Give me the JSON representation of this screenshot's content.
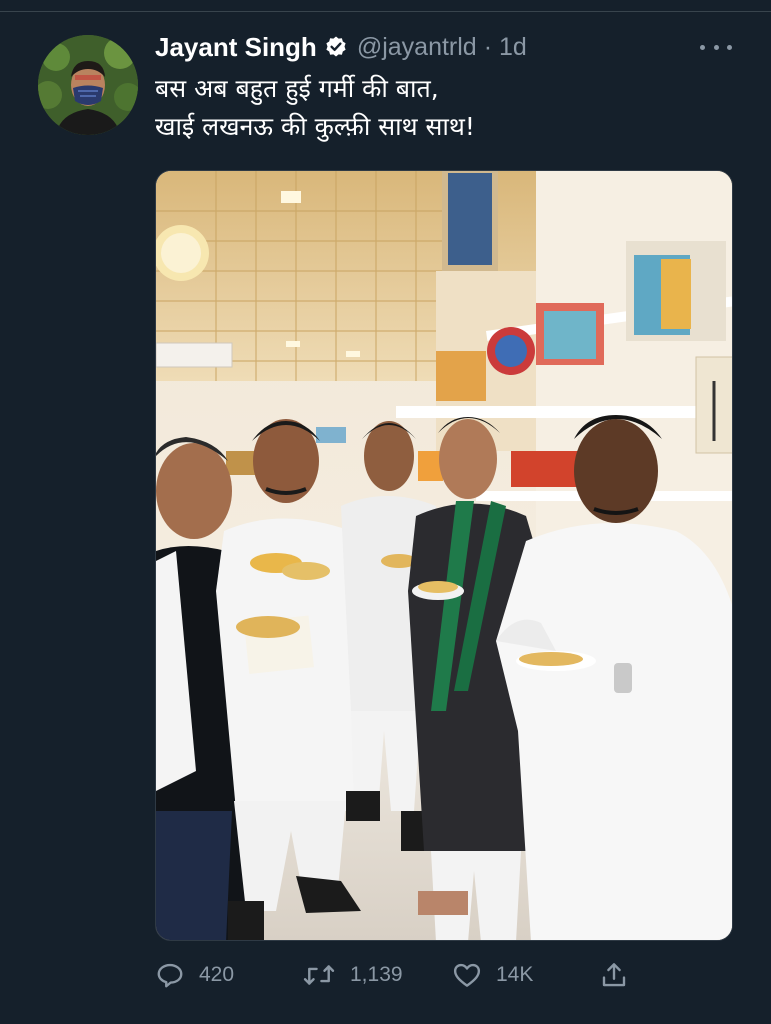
{
  "tweet": {
    "author": {
      "display_name": "Jayant Singh",
      "verified": true,
      "handle": "@jayantrld",
      "separator": "·",
      "time": "1d"
    },
    "text_lines": [
      "बस अब बहुत हुई गर्मी की बात,",
      "खाई लखनऊ की कुल्फ़ी साथ साथ!"
    ],
    "media": {
      "type": "photo"
    },
    "actions": {
      "reply_count": "420",
      "retweet_count": "1,139",
      "like_count": "14K"
    }
  },
  "theme": {
    "background": "#15202b",
    "secondary_text": "#8b98a5",
    "verified_badge": "#ffffff",
    "divider": "#38444d"
  },
  "icons": {
    "more": "more-horizontal-icon",
    "verified": "verified-badge-icon",
    "reply": "reply-icon",
    "retweet": "retweet-icon",
    "like": "heart-icon",
    "share": "share-icon"
  }
}
